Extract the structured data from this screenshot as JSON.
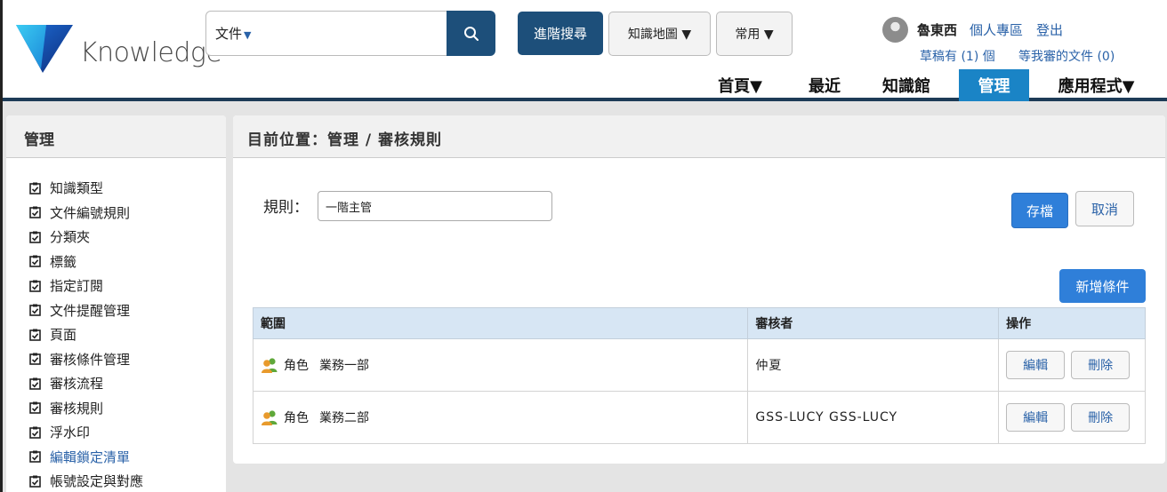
{
  "header": {
    "logo_text": "Knowledge",
    "search": {
      "scope_label": "文件",
      "query": "",
      "placeholder": ""
    },
    "advanced_search_label": "進階搜尋",
    "knowledge_map_label": "知識地圖 ▼",
    "common_label": "常用 ▼",
    "user": {
      "name": "魯東西",
      "personal_space_label": "個人專區",
      "logout_label": "登出",
      "drafts_label": "草稿有 (1) 個",
      "pending_review_label": "等我審的文件 (0)"
    },
    "nav": [
      {
        "label": "首頁▼",
        "active": false
      },
      {
        "label": "最近",
        "active": false
      },
      {
        "label": "知識館",
        "active": false
      },
      {
        "label": "管理",
        "active": true
      },
      {
        "label": "應用程式▼",
        "active": false
      }
    ],
    "colors": {
      "dark_blue": "#1d4f7a",
      "nav_active": "#1a84c6",
      "primary": "#2f7fd9",
      "link": "#2a62a8"
    }
  },
  "sidebar": {
    "title": "管理",
    "items": [
      {
        "label": "知識類型"
      },
      {
        "label": "文件編號規則"
      },
      {
        "label": "分類夾"
      },
      {
        "label": "標籤"
      },
      {
        "label": "指定訂閱"
      },
      {
        "label": "文件提醒管理"
      },
      {
        "label": "頁面"
      },
      {
        "label": "審核條件管理"
      },
      {
        "label": "審核流程"
      },
      {
        "label": "審核規則"
      },
      {
        "label": "浮水印"
      },
      {
        "label": "編輯鎖定清單"
      },
      {
        "label": "帳號設定與對應"
      }
    ]
  },
  "main": {
    "breadcrumb": "目前位置：管理 / 審核規則",
    "rule_label": "規則：",
    "rule_value": "一階主管",
    "save_label": "存檔",
    "cancel_label": "取消",
    "add_condition_label": "新增條件",
    "table": {
      "headers": [
        "範圍",
        "審核者",
        "操作"
      ],
      "rows": [
        {
          "type": "角色",
          "scope": "業務一部",
          "reviewer": "仲夏",
          "edit": "編輯",
          "delete": "刪除"
        },
        {
          "type": "角色",
          "scope": "業務二部",
          "reviewer": "GSS-LUCY GSS-LUCY",
          "edit": "編輯",
          "delete": "刪除"
        }
      ]
    }
  }
}
